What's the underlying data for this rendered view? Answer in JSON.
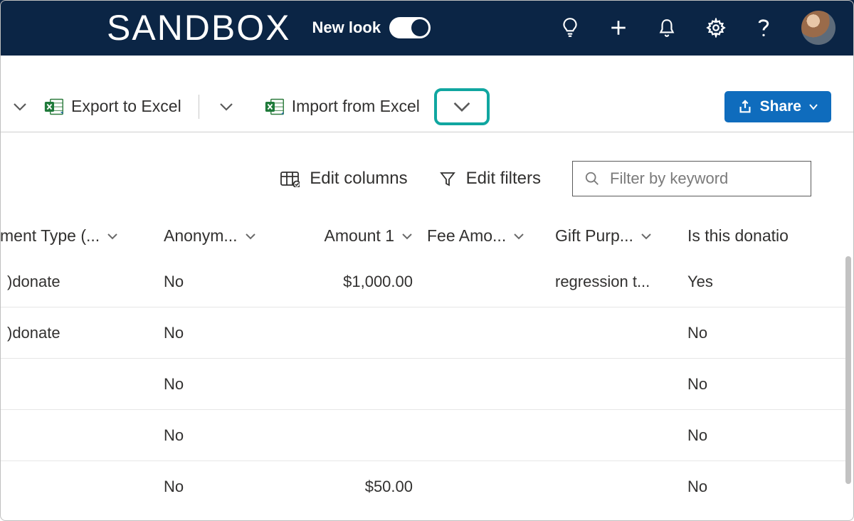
{
  "topbar": {
    "brand": "SANDBOX",
    "newlook_label": "New look",
    "newlook_on": true
  },
  "cmdbar": {
    "export_label": "Export to Excel",
    "import_label": "Import from Excel",
    "share_label": "Share"
  },
  "tools": {
    "edit_columns": "Edit columns",
    "edit_filters": "Edit filters",
    "search_placeholder": "Filter by keyword"
  },
  "table": {
    "columns": [
      {
        "label": "ment Type (..."
      },
      {
        "label": "Anonym..."
      },
      {
        "label": "Amount 1"
      },
      {
        "label": "Fee Amo..."
      },
      {
        "label": "Gift Purp..."
      },
      {
        "label": "Is this donatio"
      }
    ],
    "rows": [
      {
        "c0": ")donate",
        "c1": "No",
        "c2": "$1,000.00",
        "c3": "",
        "c4": "regression t...",
        "c5": "Yes"
      },
      {
        "c0": ")donate",
        "c1": "No",
        "c2": "",
        "c3": "",
        "c4": "",
        "c5": "No"
      },
      {
        "c0": "",
        "c1": "No",
        "c2": "",
        "c3": "",
        "c4": "",
        "c5": "No"
      },
      {
        "c0": "",
        "c1": "No",
        "c2": "",
        "c3": "",
        "c4": "",
        "c5": "No"
      },
      {
        "c0": "",
        "c1": "No",
        "c2": "$50.00",
        "c3": "",
        "c4": "",
        "c5": "No"
      }
    ]
  },
  "colors": {
    "navbar": "#0b2545",
    "accent": "#0f6cbd",
    "highlight": "#10a6a0"
  }
}
